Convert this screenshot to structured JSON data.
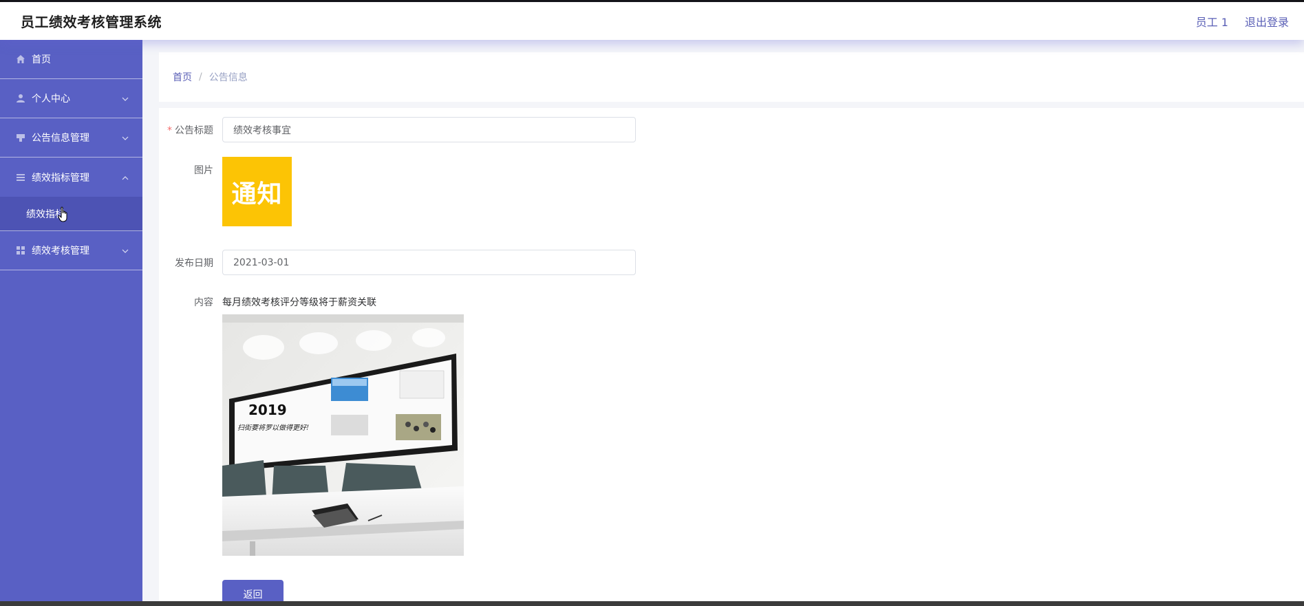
{
  "header": {
    "title": "员工绩效考核管理系统",
    "user": "员工 1",
    "logout": "退出登录"
  },
  "sidebar": {
    "items": [
      {
        "label": "首页",
        "icon": "home-icon"
      },
      {
        "label": "个人中心",
        "icon": "user-icon"
      },
      {
        "label": "公告信息管理",
        "icon": "notice-icon"
      },
      {
        "label": "绩效指标管理",
        "icon": "list-icon",
        "expanded": true,
        "children": [
          {
            "label": "绩效指标"
          }
        ]
      },
      {
        "label": "绩效考核管理",
        "icon": "grid-icon"
      }
    ]
  },
  "breadcrumb": {
    "home": "首页",
    "separator": "/",
    "current": "公告信息"
  },
  "form": {
    "title_label": "公告标题",
    "title_value": "绩效考核事宜",
    "image_label": "图片",
    "image_text": "通知",
    "date_label": "发布日期",
    "date_value": "2021-03-01",
    "content_label": "内容",
    "content_text": "每月绩效考核评分等级将于薪资关联",
    "content_image": {
      "year": "2019",
      "slogan": "扫街要将罗以做得更好!"
    },
    "back_label": "返回"
  },
  "colors": {
    "sidebar": "#5960c4",
    "accent": "#5a5fb6",
    "notice": "#fcc405"
  }
}
